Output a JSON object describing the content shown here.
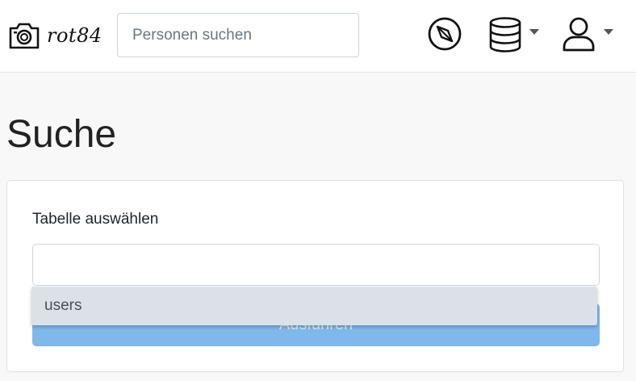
{
  "navbar": {
    "brand_text": "rot84",
    "brand_icon": "camera-icon",
    "search": {
      "placeholder": "Personen suchen",
      "value": ""
    },
    "icons": [
      "compass-icon",
      "database-icon",
      "user-icon"
    ]
  },
  "page": {
    "title": "Suche"
  },
  "form": {
    "table_label": "Tabelle auswählen",
    "table_value": "",
    "run_button_label": "Ausführen",
    "dropdown_options": [
      "users"
    ]
  },
  "colors": {
    "navbar_bg": "#ffffff",
    "page_bg": "#f8f8f8",
    "button_bg": "#7fb8ea",
    "dropdown_bg": "#dce1e7"
  }
}
